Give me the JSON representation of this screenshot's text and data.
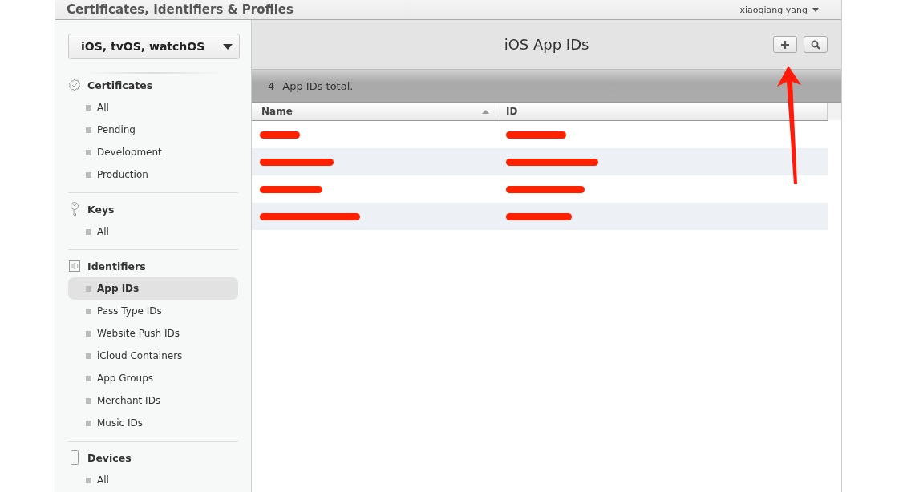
{
  "header": {
    "title": "Certificates, Identifiers & Profiles",
    "user": "xiaoqiang yang"
  },
  "platform_dropdown": {
    "value": "iOS, tvOS, watchOS"
  },
  "sidebar": {
    "sections": [
      {
        "kind": "certificates",
        "title": "Certificates",
        "items": [
          {
            "label": "All",
            "selected": false
          },
          {
            "label": "Pending",
            "selected": false
          },
          {
            "label": "Development",
            "selected": false
          },
          {
            "label": "Production",
            "selected": false
          }
        ]
      },
      {
        "kind": "keys",
        "title": "Keys",
        "items": [
          {
            "label": "All",
            "selected": false
          }
        ]
      },
      {
        "kind": "identifiers",
        "title": "Identifiers",
        "items": [
          {
            "label": "App IDs",
            "selected": true
          },
          {
            "label": "Pass Type IDs",
            "selected": false
          },
          {
            "label": "Website Push IDs",
            "selected": false
          },
          {
            "label": "iCloud Containers",
            "selected": false
          },
          {
            "label": "App Groups",
            "selected": false
          },
          {
            "label": "Merchant IDs",
            "selected": false
          },
          {
            "label": "Music IDs",
            "selected": false
          }
        ]
      },
      {
        "kind": "devices",
        "title": "Devices",
        "items": [
          {
            "label": "All",
            "selected": false
          }
        ]
      }
    ]
  },
  "main": {
    "title": "iOS App IDs",
    "count": "4",
    "count_label": "App IDs total."
  },
  "table": {
    "columns": [
      {
        "label": "Name",
        "sorted": true
      },
      {
        "label": "ID",
        "sorted": false
      }
    ],
    "rows": [
      {
        "kind": "redacted"
      },
      {
        "kind": "redacted"
      },
      {
        "kind": "redacted"
      },
      {
        "kind": "redacted"
      }
    ]
  },
  "annotation": {
    "kind": "arrow"
  }
}
